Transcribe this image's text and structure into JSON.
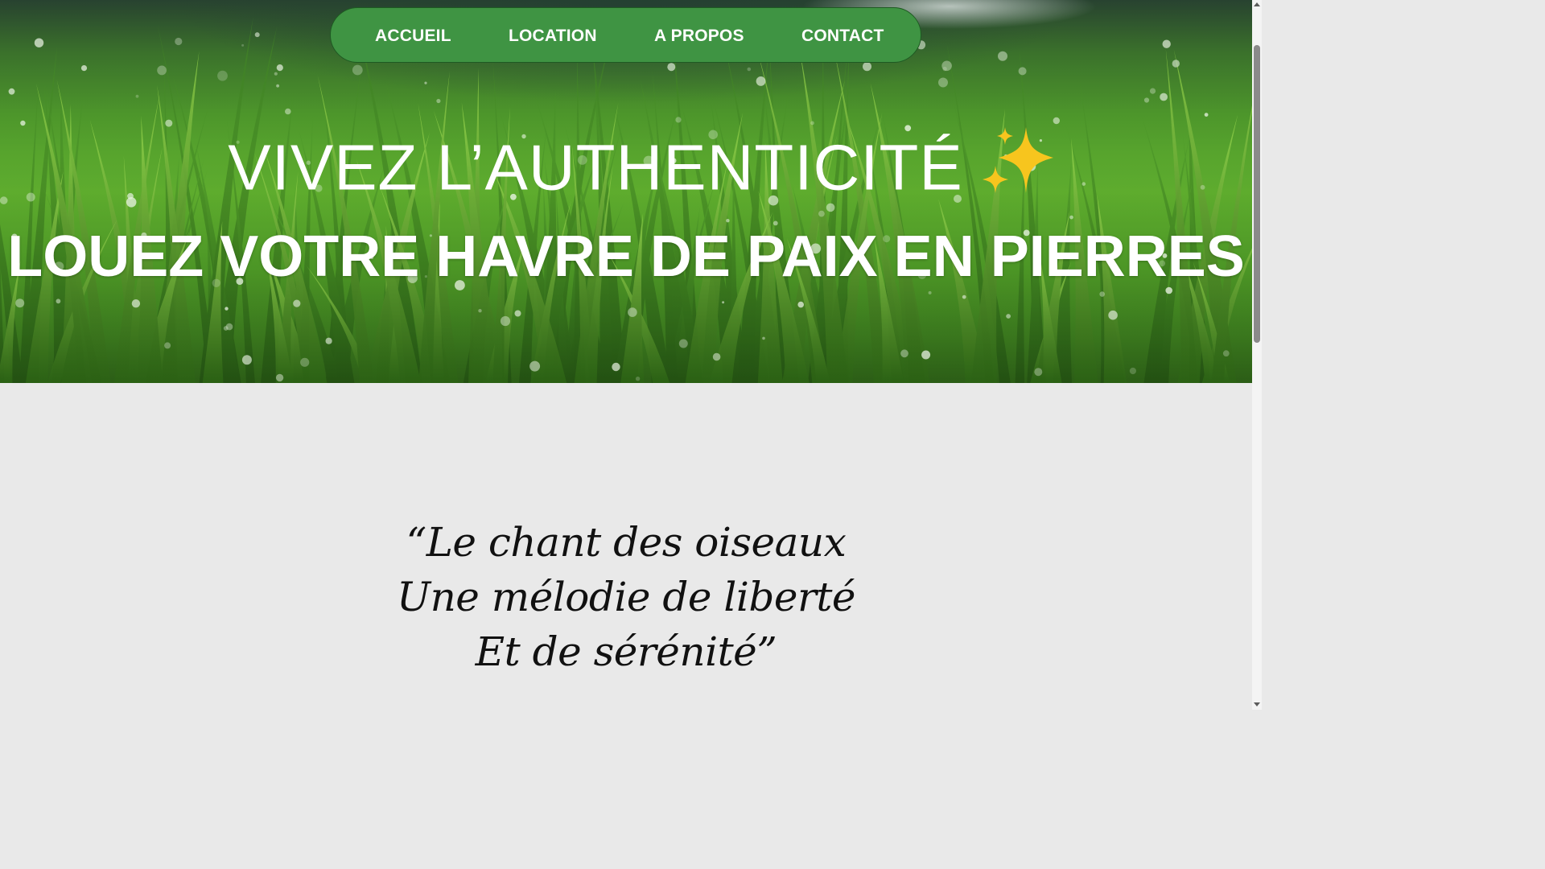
{
  "nav": {
    "items": [
      {
        "label": "ACCUEIL"
      },
      {
        "label": "LOCATION"
      },
      {
        "label": "A PROPOS"
      },
      {
        "label": "CONTACT"
      }
    ],
    "background_color": "#3f9443"
  },
  "hero": {
    "title_line1": "VIVEZ L’AUTHENTICITÉ",
    "title_line1_emoji": "sparkles-icon",
    "title_line2": "LOUEZ VOTRE HAVRE DE PAIX EN PIERRES",
    "background": "green grass with dew drops"
  },
  "quote": {
    "lines": [
      "“Le chant des oiseaux",
      "Une mélodie de liberté",
      "Et de sérénité”"
    ]
  },
  "colors": {
    "page_background": "#e9e9e9",
    "hero_text": "#ffffff",
    "quote_text": "#111111"
  }
}
